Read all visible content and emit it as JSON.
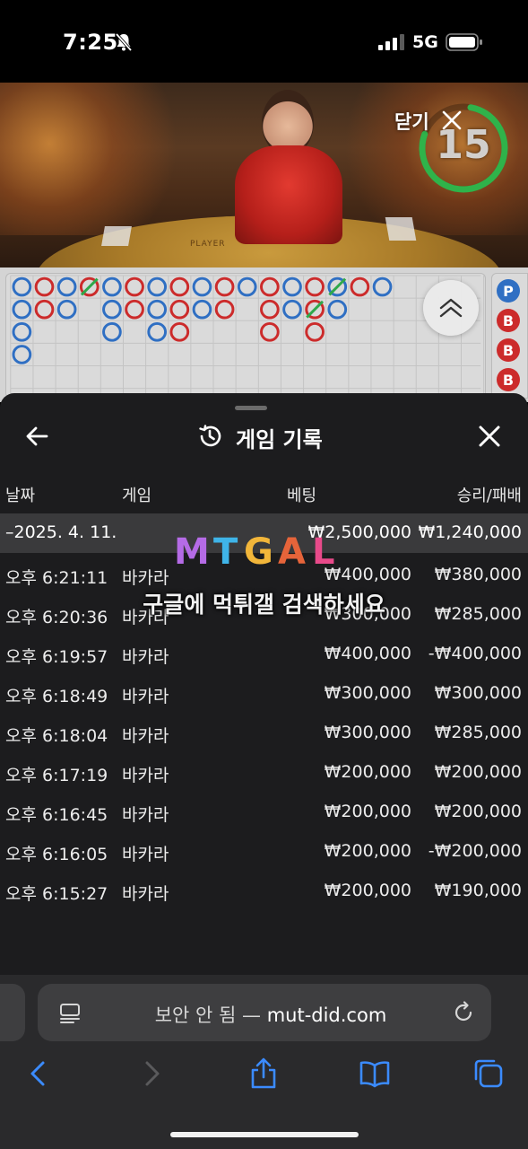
{
  "status_bar": {
    "time": "7:25",
    "network": "5G"
  },
  "video": {
    "player_label": "PLAYER",
    "close_label": "닫기",
    "timer": "15",
    "timer_color": "#2fb34a"
  },
  "scoreboard": {
    "big_road": [
      "P",
      "B",
      "B",
      "B"
    ],
    "colors": {
      "player": "#2f6fc3",
      "banker": "#cc2b2b",
      "tie": "#2fa84a"
    }
  },
  "history": {
    "title": "게임 기록",
    "columns": {
      "date": "날짜",
      "game": "게임",
      "bet": "베팅",
      "result": "승리/패배"
    },
    "summary": {
      "date": "–2025. 4. 11.",
      "bet": "₩2,500,000",
      "result": "₩1,240,000"
    },
    "rows": [
      {
        "time": "오후 6:21:11",
        "game": "바카라",
        "bet": "₩400,000",
        "result": "₩380,000"
      },
      {
        "time": "오후 6:20:36",
        "game": "바카라",
        "bet": "₩300,000",
        "result": "₩285,000"
      },
      {
        "time": "오후 6:19:57",
        "game": "바카라",
        "bet": "₩400,000",
        "result": "-₩400,000"
      },
      {
        "time": "오후 6:18:49",
        "game": "바카라",
        "bet": "₩300,000",
        "result": "₩300,000"
      },
      {
        "time": "오후 6:18:04",
        "game": "바카라",
        "bet": "₩300,000",
        "result": "₩285,000"
      },
      {
        "time": "오후 6:17:19",
        "game": "바카라",
        "bet": "₩200,000",
        "result": "₩200,000"
      },
      {
        "time": "오후 6:16:45",
        "game": "바카라",
        "bet": "₩200,000",
        "result": "₩200,000"
      },
      {
        "time": "오후 6:16:05",
        "game": "바카라",
        "bet": "₩200,000",
        "result": "-₩200,000"
      },
      {
        "time": "오후 6:15:27",
        "game": "바카라",
        "bet": "₩200,000",
        "result": "₩190,000"
      }
    ]
  },
  "watermark": {
    "logo_letters": [
      "M",
      "T",
      "G",
      "A",
      "L"
    ],
    "logo_colors": [
      "#b56be6",
      "#3fb4e8",
      "#f2b63a",
      "#e6643a",
      "#e84a8a"
    ],
    "text": "구글에 먹튀갤 검색하세요"
  },
  "browser": {
    "address_prefix": "보안 안 됨 — ",
    "address_domain": "mut-did.com"
  }
}
